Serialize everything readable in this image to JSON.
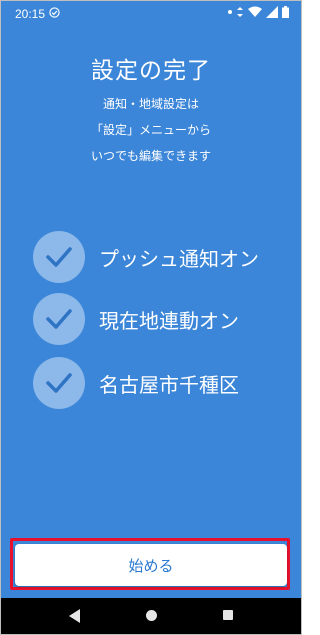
{
  "status_bar": {
    "time": "20:15",
    "icons": [
      "shield-check-icon",
      "dot-icon",
      "data-arrows-icon",
      "wifi-icon",
      "signal-icon",
      "battery-icon"
    ]
  },
  "heading": {
    "title": "設定の完了",
    "desc_line1": "通知・地域設定は",
    "desc_line2": "「設定」メニューから",
    "desc_line3": "いつでも編集できます"
  },
  "checklist": {
    "items": [
      {
        "label": "プッシュ通知オン",
        "icon": "check-icon"
      },
      {
        "label": "現在地連動オン",
        "icon": "check-icon"
      },
      {
        "label": "名古屋市千種区",
        "icon": "check-icon"
      }
    ]
  },
  "actions": {
    "start_label": "始める"
  },
  "nav_bar": {
    "icons": [
      "back-icon",
      "home-icon",
      "recents-icon"
    ]
  },
  "colors": {
    "background": "#3b86d8",
    "check_circle": "#8cb8ea",
    "button_text": "#2a78d1",
    "highlight": "#e8112d"
  }
}
